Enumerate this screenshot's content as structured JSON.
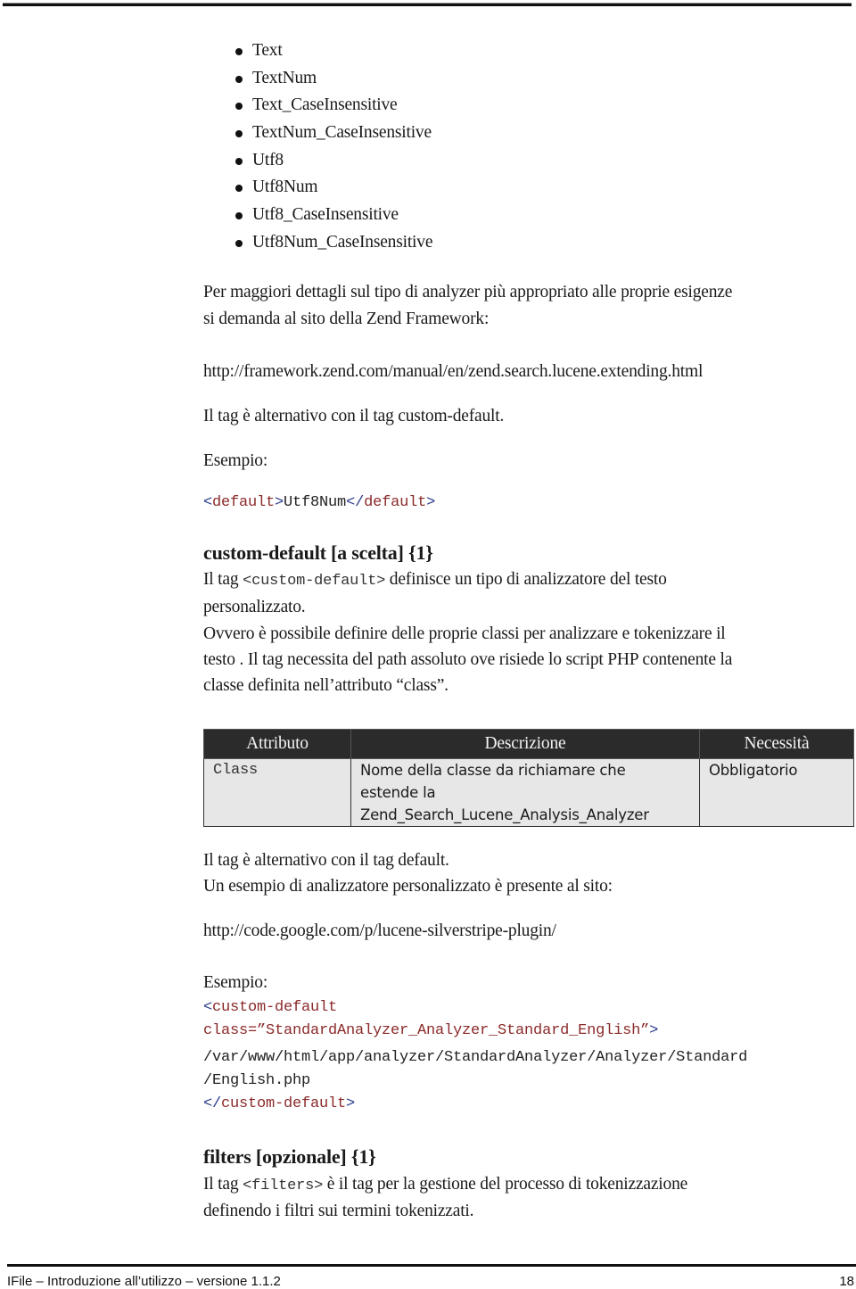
{
  "analyzer_list": [
    "Text",
    "TextNum",
    "Text_CaseInsensitive",
    "TextNum_CaseInsensitive",
    "Utf8",
    "Utf8Num",
    "Utf8_CaseInsensitive",
    "Utf8Num_CaseInsensitive"
  ],
  "intro": {
    "line1": "Per maggiori dettagli sul tipo di analyzer più appropriato alle proprie esigenze",
    "line2": "si demanda al sito della Zend Framework:",
    "url": "http://framework.zend.com/manual/en/zend.search.lucene.extending.html",
    "alt_note": "Il tag è alternativo con il tag custom-default.",
    "example_label": "Esempio:",
    "example_code": {
      "open_lt": "<",
      "open_tag": "default",
      "open_gt": ">",
      "value": "Utf8Num",
      "close_lt": "</",
      "close_tag": "default",
      "close_gt": ">"
    }
  },
  "custom_default": {
    "heading": "custom-default [a scelta] {1}",
    "desc_prefix": "Il tag ",
    "desc_code": "<custom-default>",
    "desc_suffix": " definisce un tipo di analizzatore del testo",
    "desc_line2": "personalizzato.",
    "desc_line3": "Ovvero è possibile definire delle proprie classi per analizzare e tokenizzare  il",
    "desc_line4": "testo . Il tag necessita del path assoluto ove risiede lo script PHP contenente la",
    "desc_line5": "classe definita nell’attributo “class”.",
    "table": {
      "headers": [
        "Attributo",
        "Descrizione",
        "Necessità"
      ],
      "rows": [
        {
          "attribute": "Class",
          "description_lines": [
            "Nome della classe da richiamare che",
            "estende la",
            "Zend_Search_Lucene_Analysis_Analyzer"
          ],
          "necessity": "Obbligatorio"
        }
      ]
    },
    "alt_note": "Il tag è alternativo con il tag default.",
    "example_site_note": "Un esempio di analizzatore personalizzato è presente al sito:",
    "example_url": "http://code.google.com/p/lucene-silverstripe-plugin/",
    "example_label": "Esempio:",
    "example_code": {
      "line1_lt": "<",
      "line1_tag": "custom-default",
      "line2_attr": "class=”StandardAnalyzer_Analyzer_Standard_English”",
      "line2_gt": ">",
      "line3_a": "/var/www/html/app/",
      "line3_b": "analyzer/StandardAnalyzer/Analyzer/Standard",
      "line4": "/English.php",
      "line5_lt": "</",
      "line5_tag": "custom-default",
      "line5_gt": ">"
    }
  },
  "filters": {
    "heading": "filters  [opzionale] {1}",
    "desc_prefix": "Il tag ",
    "desc_code": "<filters>",
    "desc_suffix": " è il tag per la gestione del processo di tokenizzazione",
    "desc_line2": "definendo i filtri sui termini tokenizzati."
  },
  "footer": {
    "title": "IFile – Introduzione all’utilizzo – versione 1.1.2",
    "page_number": "18"
  }
}
